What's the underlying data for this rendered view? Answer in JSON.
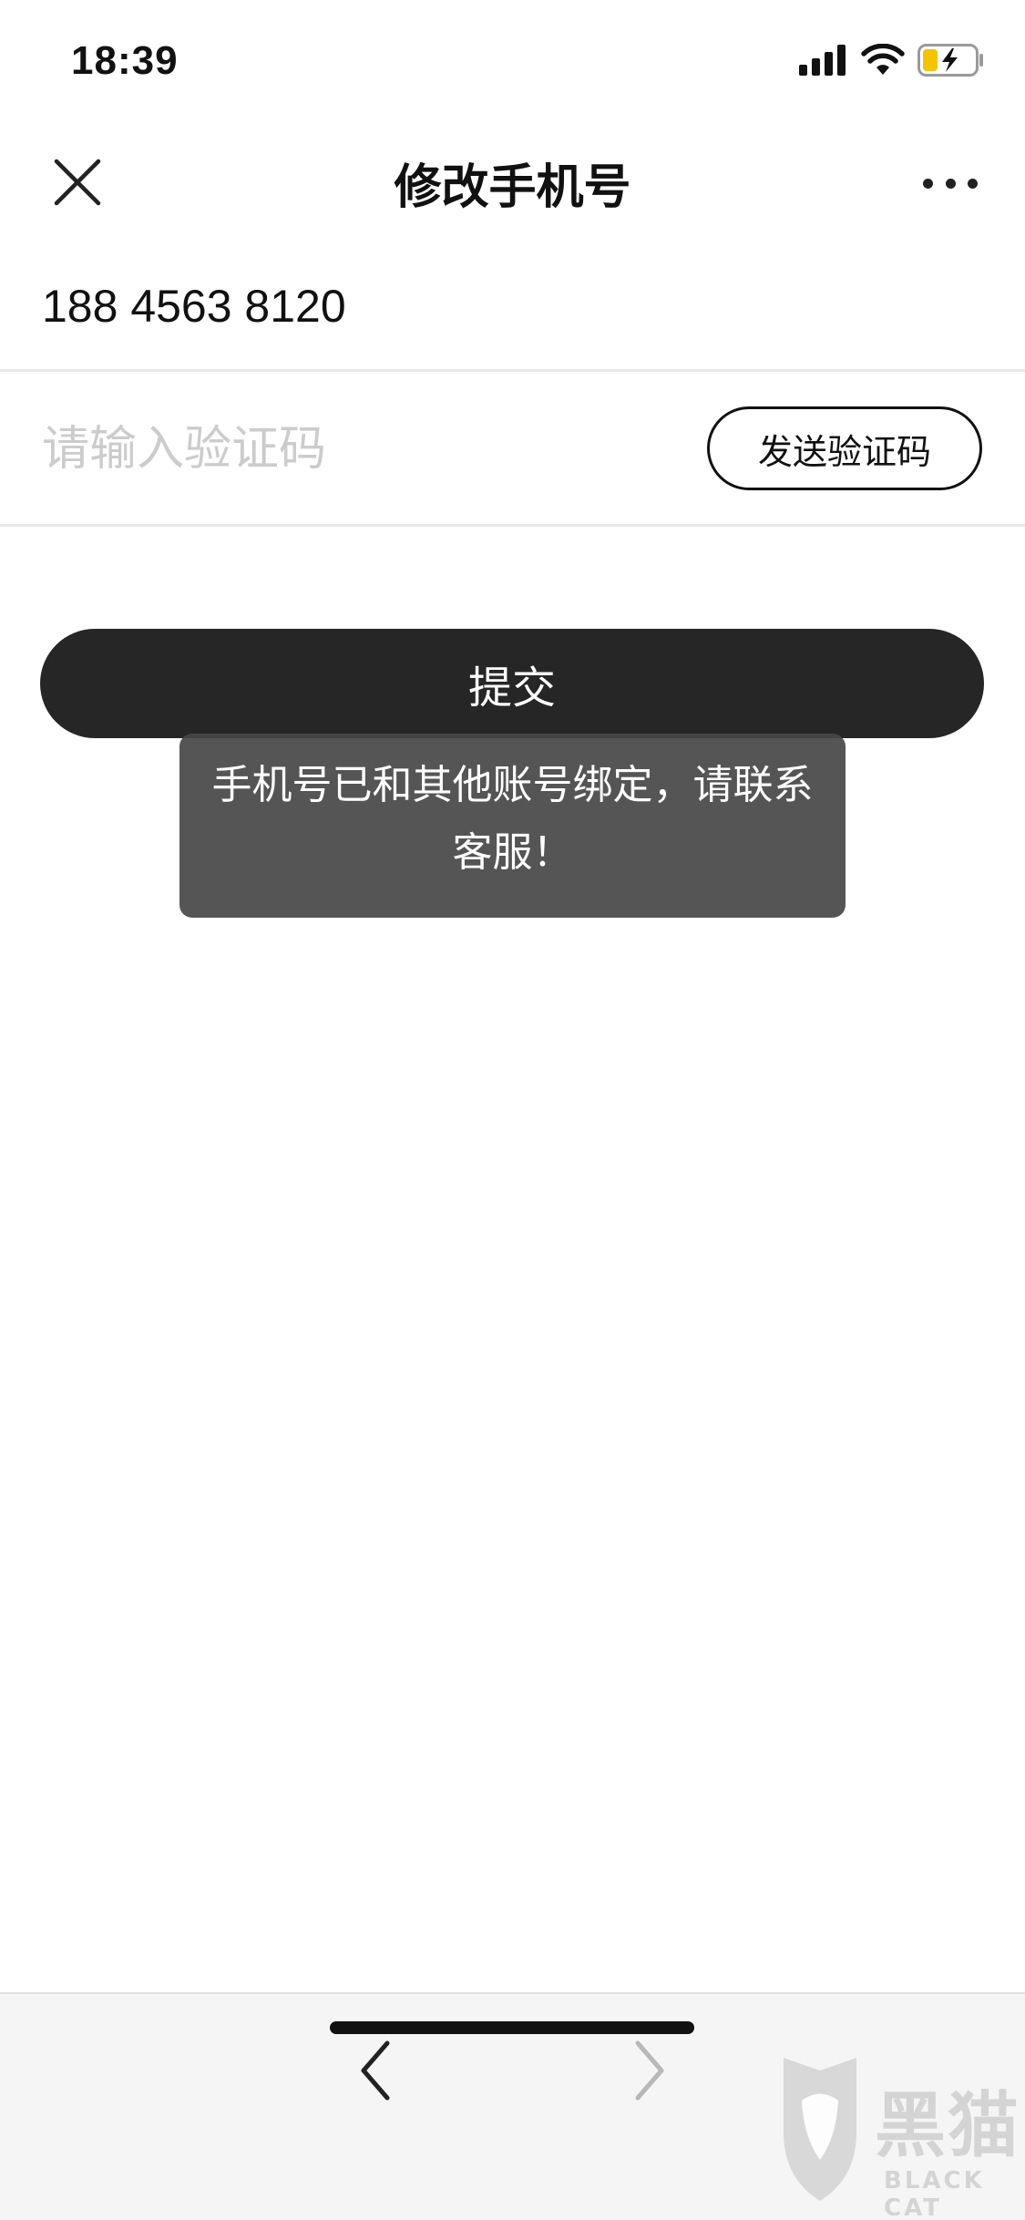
{
  "status_bar": {
    "time": "18:39",
    "icons": [
      "signal-icon",
      "wifi-icon",
      "battery-charging-icon"
    ]
  },
  "nav": {
    "title": "修改手机号",
    "close_icon": "close-icon",
    "more_icon": "more-icon"
  },
  "form": {
    "phone_number": "188 4563 8120",
    "code_value": "",
    "code_placeholder": "请输入验证码",
    "send_code_label": "发送验证码",
    "submit_label": "提交"
  },
  "toast": {
    "line1": "手机号已和其他账号绑定，请联系",
    "line2": "客服！"
  },
  "bottom_bar": {
    "back_icon": "chevron-left-icon",
    "forward_icon": "chevron-right-icon"
  },
  "watermark": {
    "cn": "黑猫",
    "en": "BLACK CAT"
  },
  "colors": {
    "submit_bg": "#262626",
    "toast_bg": "#464646",
    "placeholder": "#cccccc",
    "battery_fill": "#f5c400",
    "divider": "#e8e8e8"
  }
}
